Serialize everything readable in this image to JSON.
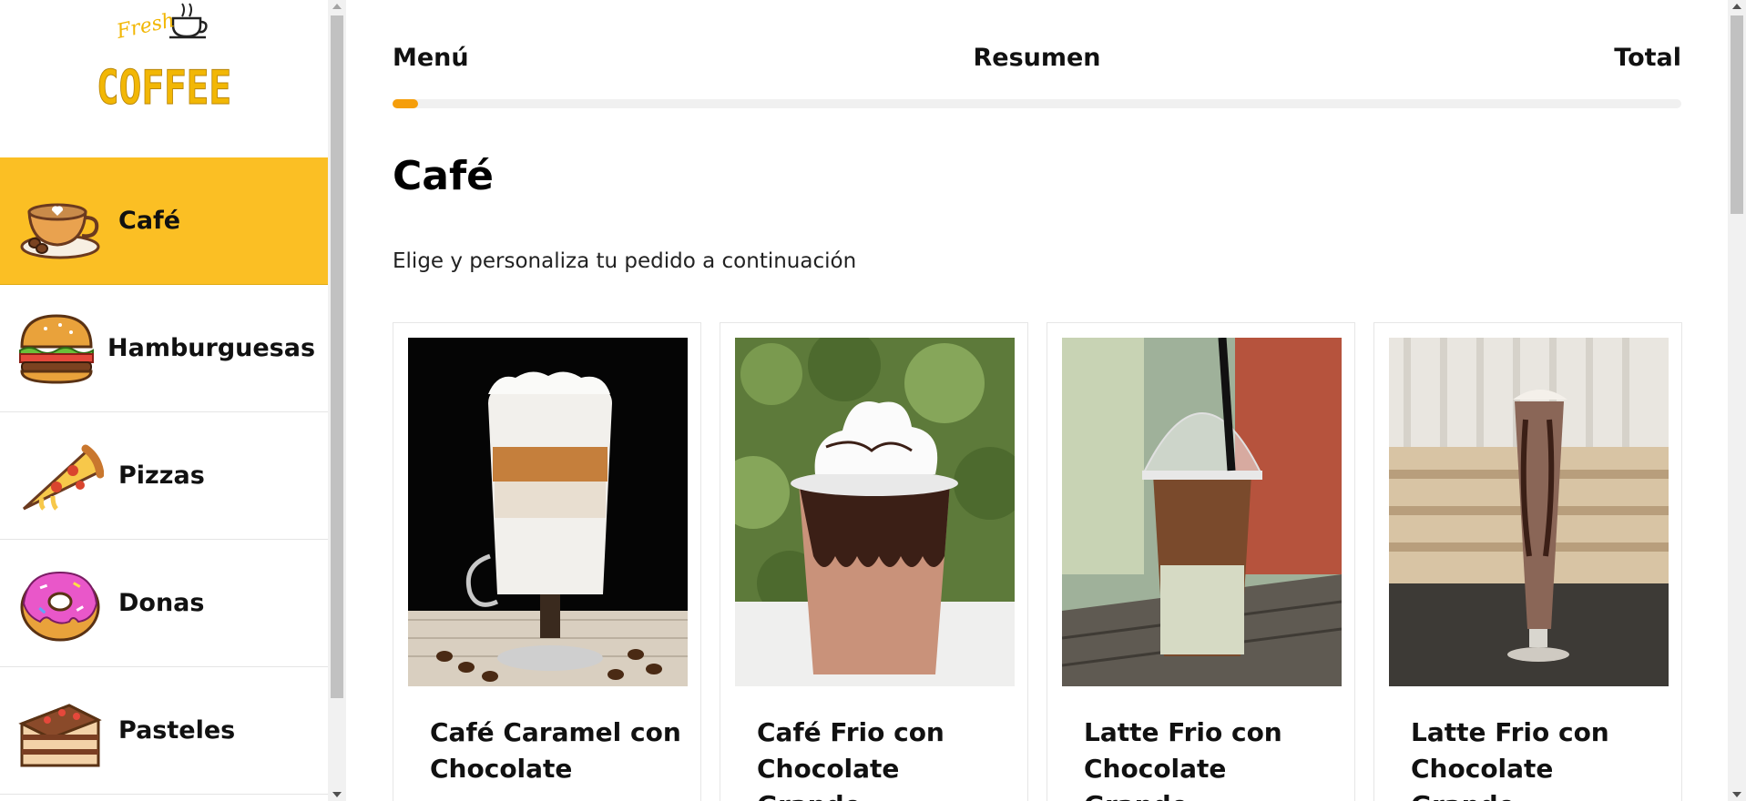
{
  "brand": {
    "logo_script": "Fresh",
    "logo_main": "COFFEE"
  },
  "sidebar": {
    "items": [
      {
        "label": "Café",
        "icon": "coffee-cup-icon",
        "active": true
      },
      {
        "label": "Hamburguesas",
        "icon": "burger-icon",
        "active": false
      },
      {
        "label": "Pizzas",
        "icon": "pizza-slice-icon",
        "active": false
      },
      {
        "label": "Donas",
        "icon": "donut-icon",
        "active": false
      },
      {
        "label": "Pasteles",
        "icon": "cake-slice-icon",
        "active": false
      }
    ]
  },
  "steps": {
    "menu": "Menú",
    "summary": "Resumen",
    "total": "Total",
    "progress": 0.02
  },
  "page": {
    "title": "Café",
    "subtitle": "Elige y personaliza tu pedido a continuación"
  },
  "products": [
    {
      "name": "Café Caramel con Chocolate"
    },
    {
      "name": "Café Frio con Chocolate Grande"
    },
    {
      "name": "Latte Frio con Chocolate Grande"
    },
    {
      "name": "Latte Frio con Chocolate Grande"
    }
  ],
  "colors": {
    "accent": "#fbbf24",
    "progress": "#f59e0b"
  }
}
